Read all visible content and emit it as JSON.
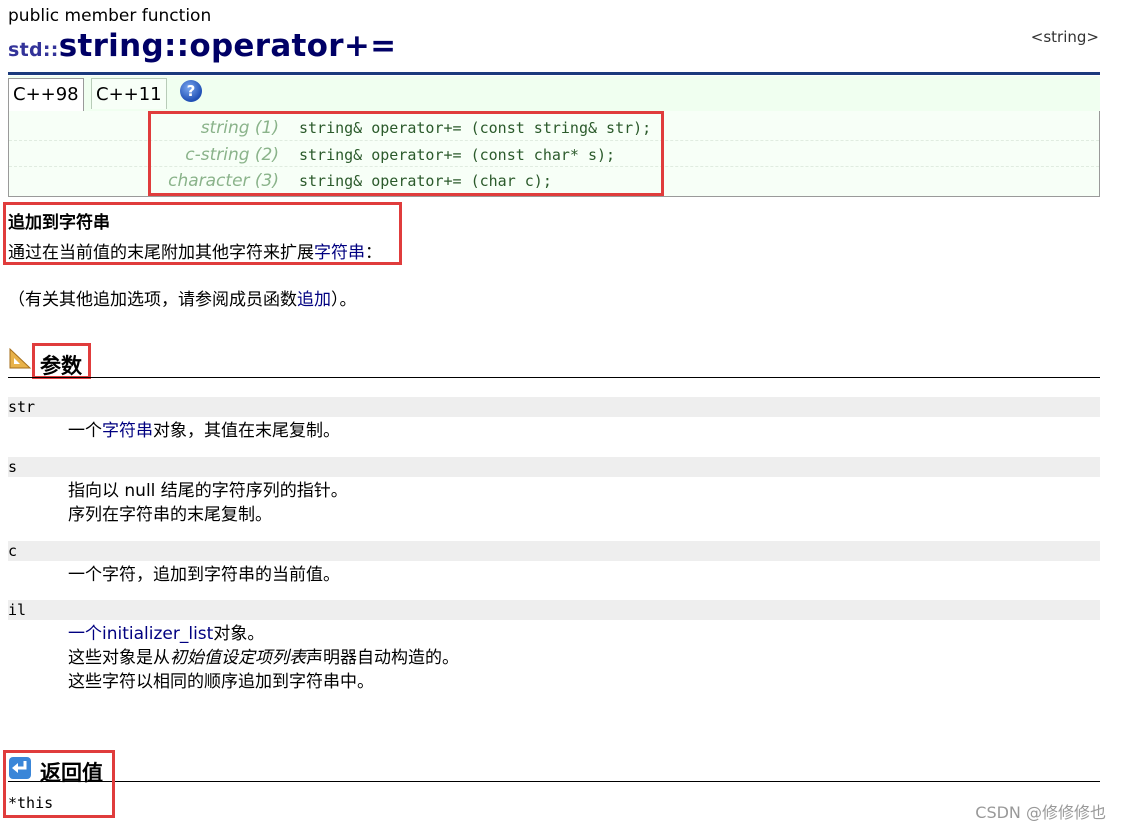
{
  "header": {
    "member_type": "public member function",
    "namespace": "std::",
    "title": "string::operator+=",
    "header_ref": "<string>"
  },
  "tabs": [
    {
      "label": "C++98",
      "active": true
    },
    {
      "label": "C++11",
      "active": false
    }
  ],
  "help_icon": "question-mark-icon",
  "prototypes": [
    {
      "label": "string (1)",
      "code": "string& operator+= (const string& str);"
    },
    {
      "label": "c-string (2)",
      "code": "string& operator+= (const char* s);"
    },
    {
      "label": "character (3)",
      "code": "string& operator+= (char c);"
    }
  ],
  "description": {
    "title": "追加到字符串",
    "text_before": "通过在当前值的末尾附加其他字符来扩展",
    "text_link": "字符串",
    "text_after": "：",
    "note_before": "（有关其他追加选项，请参阅成员函数",
    "note_link": "追加",
    "note_after": "）。"
  },
  "parameters": {
    "heading": "参数",
    "icon": "set-square-ruler-icon",
    "items": [
      {
        "term": "str",
        "lines": [
          {
            "before": "一个",
            "link": "字符串",
            "after": "对象，其值在末尾复制。"
          }
        ]
      },
      {
        "term": "s",
        "lines": [
          {
            "before": "指向以 null 结尾的字符序列的指针。",
            "link": "",
            "after": ""
          },
          {
            "before": "序列在字符串的末尾复制。",
            "link": "",
            "after": ""
          }
        ]
      },
      {
        "term": "c",
        "lines": [
          {
            "before": "一个字符，追加到字符串的当前值。",
            "link": "",
            "after": ""
          }
        ]
      },
      {
        "term": "il",
        "lines": [
          {
            "before": "",
            "link": "一个initializer_list",
            "after": "对象。"
          },
          {
            "before": "这些对象是从",
            "italic": "初始值设定项列表",
            "after": "声明器自动构造的。"
          },
          {
            "before": "这些字符以相同的顺序追加到字符串中。",
            "link": "",
            "after": ""
          }
        ]
      }
    ]
  },
  "return_value": {
    "heading": "返回值",
    "icon": "return-arrow-icon",
    "value": "*this"
  },
  "colors": {
    "title": "#000066",
    "rule": "#1b3a7c",
    "highlight_box": "#e03c3c",
    "proto_bg": "#f7fff7",
    "link": "#000080"
  },
  "watermark": "CSDN @修修修也"
}
